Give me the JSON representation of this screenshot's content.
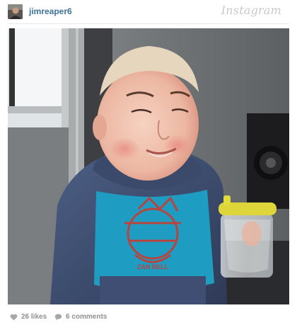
{
  "post": {
    "username": "jimreaper6",
    "brand": "Instagram",
    "likes": "26 likes",
    "comments": "6 comments"
  },
  "icons": {
    "like": "heart-icon",
    "comment": "speech-bubble-icon"
  },
  "colors": {
    "username": "#3f729b",
    "meta": "#8f8f8f",
    "brand": "#c9c9c9"
  }
}
